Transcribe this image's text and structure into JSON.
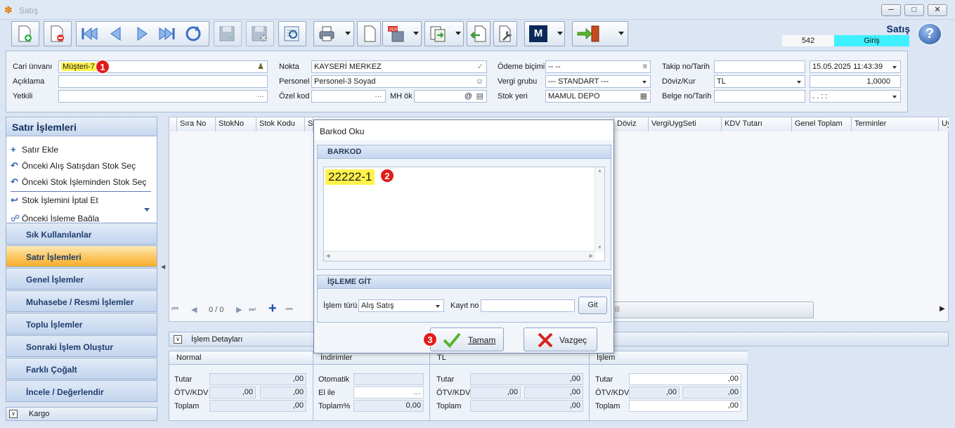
{
  "window": {
    "title": "Satış"
  },
  "header": {
    "form_title": "Satış",
    "record_no": "542",
    "mode": "Giriş"
  },
  "form": {
    "cari_label": "Cari ünvanı",
    "cari_value": "Müşteri-7",
    "aciklama_label": "Açıklama",
    "aciklama_value": "",
    "yetkili_label": "Yetkili",
    "yetkili_value": "",
    "nokta_label": "Nokta",
    "nokta_value": "KAYSERİ MERKEZ",
    "personel_label": "Personel",
    "personel_value": "Personel-3 Soyad",
    "ozelkod_label": "Özel kod",
    "ozelkod_value": "",
    "mhok_label": "MH ök",
    "mhok_value": "",
    "odeme_label": "Ödeme biçimi",
    "odeme_value": "-- --",
    "vergi_label": "Vergi grubu",
    "vergi_value": "--- STANDART ---",
    "stok_label": "Stok yeri",
    "stok_value": "MAMUL DEPO",
    "takip_label": "Takip no/Tarih",
    "takip_value": "",
    "takip_date": "15.05.2025 11:43:39",
    "doviz_label": "Döviz/Kur",
    "doviz_value": "TL",
    "kur_value": "1,0000",
    "belge_label": "Belge no/Tarih",
    "belge_value": "",
    "belge_date": " .  .     :  :"
  },
  "left_panel": {
    "title": "Satır İşlemleri",
    "items": [
      {
        "label": "Satır Ekle",
        "icon": "plus-icon"
      },
      {
        "label": "Önceki Alış Satışdan Stok Seç",
        "icon": "arrow-back-icon"
      },
      {
        "label": "Önceki Stok İşleminden Stok Seç",
        "icon": "arrow-back-icon"
      },
      {
        "label": "Stok İşlemini İptal Et",
        "icon": "undo-icon"
      },
      {
        "label": "Önceki İşleme Bağla",
        "icon": "link-icon"
      }
    ],
    "nav": [
      "Sık Kullanılanlar",
      "Satır İşlemleri",
      "Genel İşlemler",
      "Muhasebe / Resmi İşlemler",
      "Toplu İşlemler",
      "Sonraki İşlem Oluştur",
      "Farklı Çoğalt",
      "İncele / Değerlendir"
    ],
    "kargo": "Kargo"
  },
  "grid": {
    "columns": [
      "Sıra No",
      "StokNo",
      "Stok Kodu",
      "S",
      "Döviz",
      "VergiUygSeti",
      "KDV Tutarı",
      "Genel Toplam",
      "Terminler",
      "Uy"
    ],
    "pager": "0 / 0"
  },
  "details": {
    "bar_label": "İşlem Detayları",
    "normal": {
      "title": "Normal",
      "tutar_label": "Tutar",
      "tutar": ",00",
      "otv_label": "ÖTV/KDV",
      "otv1": ",00",
      "otv2": ",00",
      "toplam_label": "Toplam",
      "toplam": ",00"
    },
    "indirimler": {
      "title": "İndirimler",
      "otomatik_label": "Otomatik",
      "otomatik": "",
      "elile_label": "El ile",
      "elile": "",
      "toplam_label": "Toplam%",
      "toplam": "0,00"
    },
    "tl": {
      "title": "TL",
      "tutar_label": "Tutar",
      "tutar": ",00",
      "otv_label": "ÖTV/KDV",
      "otv1": ",00",
      "otv2": ",00",
      "toplam_label": "Toplam",
      "toplam": ",00"
    },
    "islem": {
      "title": "İşlem",
      "tutar_label": "Tutar",
      "tutar": ",00",
      "otv_label": "ÖTV/KDV",
      "otv1": ",00",
      "otv2": ",00",
      "toplam_label": "Toplam",
      "toplam": ",00"
    }
  },
  "dialog": {
    "title": "Barkod Oku",
    "barkod_header": "BARKOD",
    "barkod_value": "22222-1",
    "goto_header": "İŞLEME GİT",
    "islem_turu_label": "İşlem türü",
    "islem_turu_value": "Alış Satış",
    "kayit_no_label": "Kayıt no",
    "kayit_no_value": "",
    "git_label": "Git",
    "tamam_label": "Tamam",
    "vazgec_label": "Vazgeç"
  },
  "markers": [
    "1",
    "2",
    "3"
  ]
}
